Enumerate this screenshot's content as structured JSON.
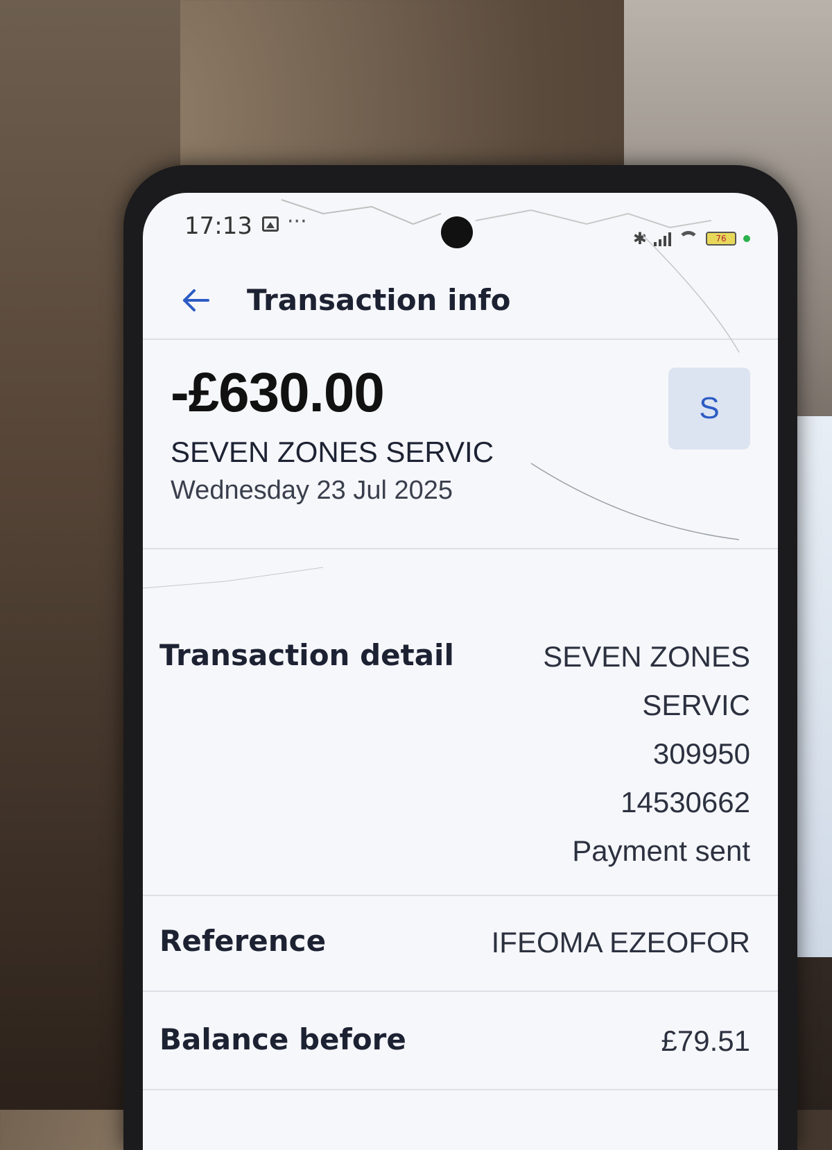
{
  "status_bar": {
    "time": "17:13",
    "dots": "···",
    "battery": "76"
  },
  "header": {
    "back_icon": "arrow-left-icon",
    "title": "Transaction info"
  },
  "summary": {
    "amount": "-£630.00",
    "merchant": "SEVEN ZONES SERVIC",
    "date": "Wednesday 23 Jul 2025",
    "avatar_letter": "S"
  },
  "details": [
    {
      "label": "Transaction detail",
      "values": [
        "SEVEN ZONES",
        "SERVIC",
        "309950",
        "14530662",
        "Payment sent"
      ]
    },
    {
      "label": "Reference",
      "values": [
        "IFEOMA EZEOFOR"
      ]
    },
    {
      "label": "Balance before",
      "values": [
        "£79.51"
      ]
    }
  ],
  "colors": {
    "accent": "#2c5bc4",
    "avatar_bg": "#dce3f1",
    "text_primary": "#1d2233",
    "divider": "#dde0e6"
  }
}
